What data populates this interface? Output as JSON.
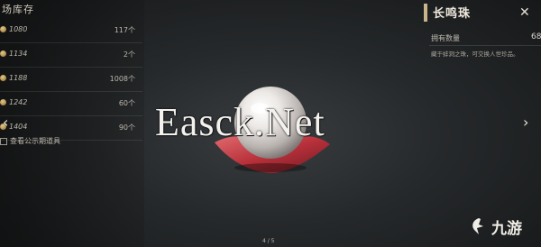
{
  "panel": {
    "title": "场库存",
    "rows": [
      {
        "price": "1080",
        "qty": "117个"
      },
      {
        "price": "1134",
        "qty": "2个"
      },
      {
        "price": "1188",
        "qty": "1008个"
      },
      {
        "price": "1242",
        "qty": "60个"
      },
      {
        "price": "1404",
        "qty": "90个"
      }
    ],
    "hint": "查看公示期道具"
  },
  "item": {
    "name": "长鸣珠",
    "owned_label": "拥有数量",
    "owned_value": "68",
    "description": "藏于蚌洞之珠，可交换人世珍品。"
  },
  "navigation": {
    "left_arrow": "‹",
    "right_arrow": "›",
    "close": "✕",
    "page": "4 / 5"
  },
  "watermark": "Easck.Net",
  "logo": {
    "text": "九游"
  },
  "colors": {
    "accent": "#c9b48a",
    "pearl_cloth": "#b8303a"
  }
}
